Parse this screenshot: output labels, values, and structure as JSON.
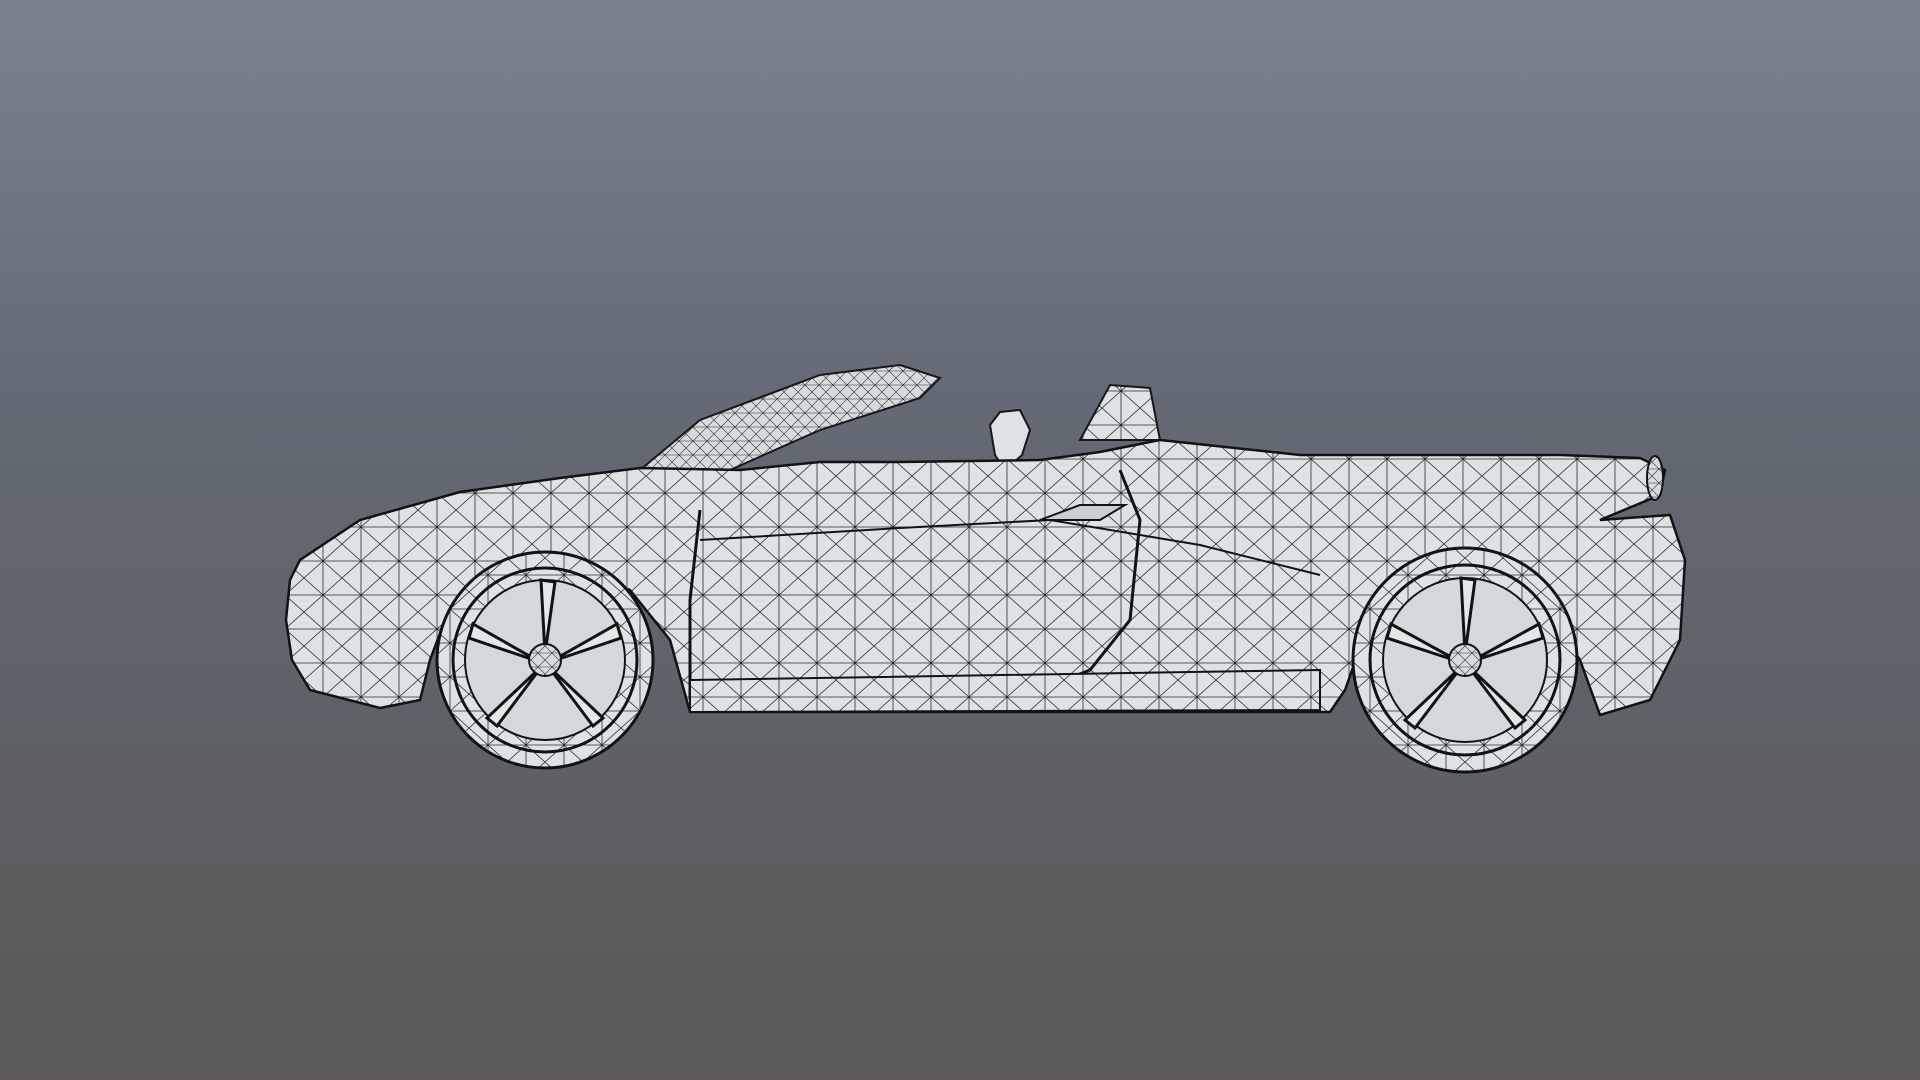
{
  "scene": {
    "view_mode": "wireframe",
    "object": "convertible-sports-car-mesh",
    "view": "side",
    "colors": {
      "background_top": "#7b828d",
      "background_mid": "#646b76",
      "background_bottom": "#5b5857",
      "mesh_fill": "#dde3e4",
      "mesh_wire": "#1b1d1f"
    }
  }
}
